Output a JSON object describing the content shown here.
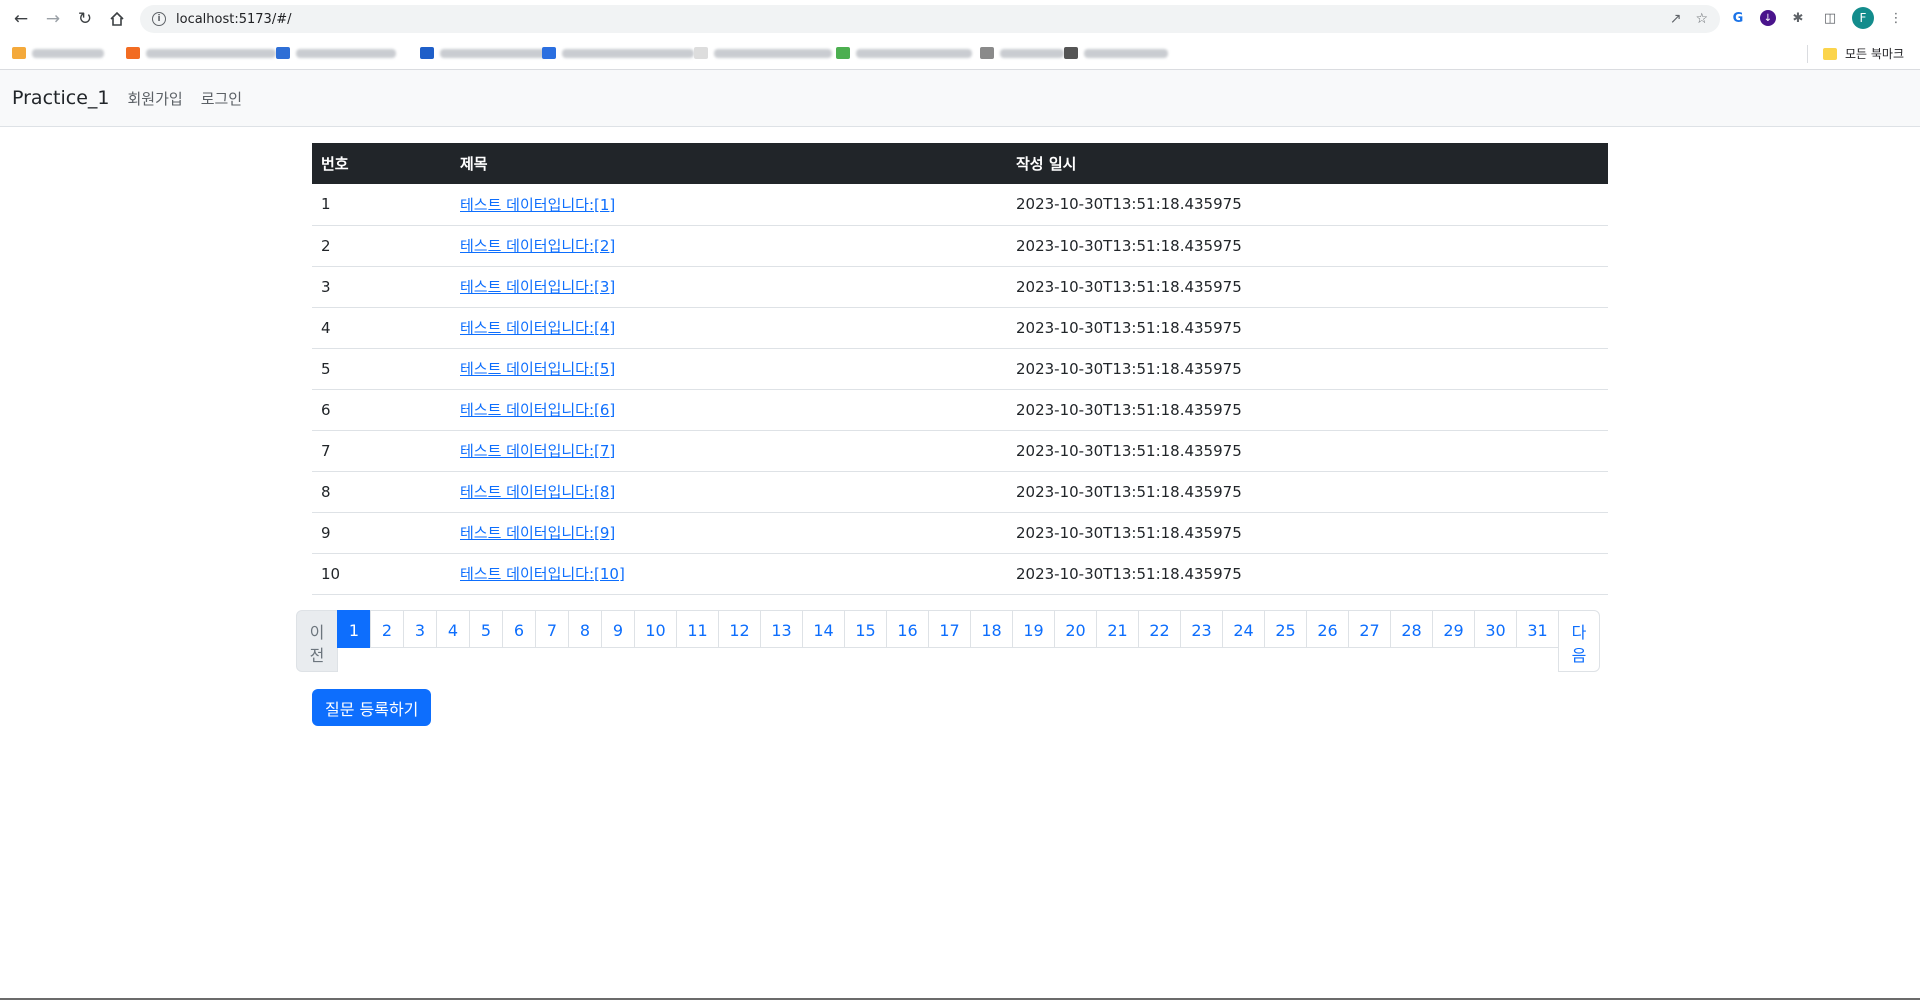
{
  "browser": {
    "url": "localhost:5173/#/",
    "all_bookmarks_label": "모든 북마크",
    "avatar_letter": "F",
    "bookmark_favicon_colors": [
      "#f4a93b",
      "#f26c22",
      "#2f6fd6",
      "#1f5fc9",
      "#2b6fe0",
      "#dddddd",
      "#4caf50",
      "#8a8a8a",
      "#555555",
      "#777777"
    ]
  },
  "navbar": {
    "brand": "Practice_1",
    "links": [
      "회원가입",
      "로그인"
    ]
  },
  "table": {
    "headers": [
      "번호",
      "제목",
      "작성 일시"
    ],
    "rows": [
      {
        "num": "1",
        "title": "테스트 데이터입니다:[1]",
        "date": "2023-10-30T13:51:18.435975"
      },
      {
        "num": "2",
        "title": "테스트 데이터입니다:[2]",
        "date": "2023-10-30T13:51:18.435975"
      },
      {
        "num": "3",
        "title": "테스트 데이터입니다:[3]",
        "date": "2023-10-30T13:51:18.435975"
      },
      {
        "num": "4",
        "title": "테스트 데이터입니다:[4]",
        "date": "2023-10-30T13:51:18.435975"
      },
      {
        "num": "5",
        "title": "테스트 데이터입니다:[5]",
        "date": "2023-10-30T13:51:18.435975"
      },
      {
        "num": "6",
        "title": "테스트 데이터입니다:[6]",
        "date": "2023-10-30T13:51:18.435975"
      },
      {
        "num": "7",
        "title": "테스트 데이터입니다:[7]",
        "date": "2023-10-30T13:51:18.435975"
      },
      {
        "num": "8",
        "title": "테스트 데이터입니다:[8]",
        "date": "2023-10-30T13:51:18.435975"
      },
      {
        "num": "9",
        "title": "테스트 데이터입니다:[9]",
        "date": "2023-10-30T13:51:18.435975"
      },
      {
        "num": "10",
        "title": "테스트 데이터입니다:[10]",
        "date": "2023-10-30T13:51:18.435975"
      }
    ]
  },
  "pagination": {
    "prev_label": [
      "이",
      "전"
    ],
    "next_label": [
      "다",
      "음"
    ],
    "pages": [
      "1",
      "2",
      "3",
      "4",
      "5",
      "6",
      "7",
      "8",
      "9",
      "10",
      "11",
      "12",
      "13",
      "14",
      "15",
      "16",
      "17",
      "18",
      "19",
      "20",
      "21",
      "22",
      "23",
      "24",
      "25",
      "26",
      "27",
      "28",
      "29",
      "30",
      "31"
    ],
    "active_page": "1"
  },
  "create_button_label": "질문 등록하기",
  "colors": {
    "primary": "#0d6efd",
    "table_header_bg": "#212529",
    "navbar_bg": "#f8f9fa"
  }
}
